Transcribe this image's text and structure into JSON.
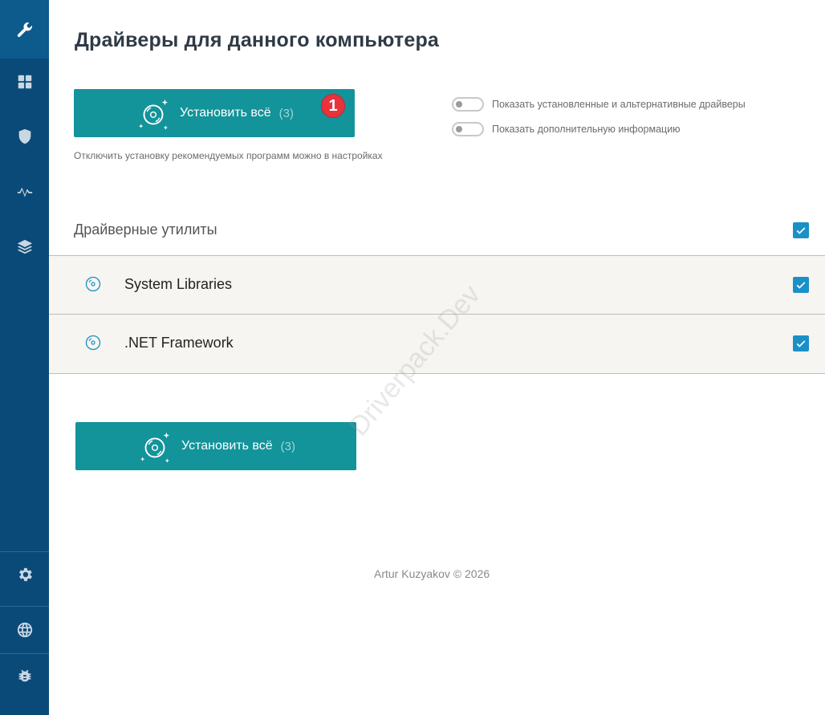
{
  "sidebar": {
    "items": [
      {
        "icon": "wrench-icon",
        "active": true
      },
      {
        "icon": "grid-icon",
        "active": false
      },
      {
        "icon": "shield-icon",
        "active": false
      },
      {
        "icon": "pulse-icon",
        "active": false
      },
      {
        "icon": "layers-icon",
        "active": false
      }
    ],
    "bottom_items": [
      {
        "icon": "gear-icon"
      },
      {
        "icon": "globe-icon"
      },
      {
        "icon": "bug-icon"
      }
    ]
  },
  "page": {
    "title": "Драйверы для данного компьютера"
  },
  "install": {
    "label": "Установить всё",
    "count": "(3)",
    "badge": "1"
  },
  "hint": "Отключить установку рекомендуемых программ можно в настройках",
  "toggles": [
    {
      "label": "Показать установленные и альтернативные драйверы",
      "on": false
    },
    {
      "label": "Показать дополнительную информацию",
      "on": false
    }
  ],
  "section": {
    "title": "Драйверные утилиты",
    "checked": true
  },
  "list": [
    {
      "label": "System Libraries",
      "checked": true
    },
    {
      "label": ".NET Framework",
      "checked": true
    }
  ],
  "watermark": "Driverpack.Dev",
  "footer": "Artur Kuzyakov © 2026",
  "colors": {
    "sidebar": "#0a4a78",
    "button": "#13939a",
    "badge": "#e8323c",
    "checkbox": "#1b90c7"
  }
}
